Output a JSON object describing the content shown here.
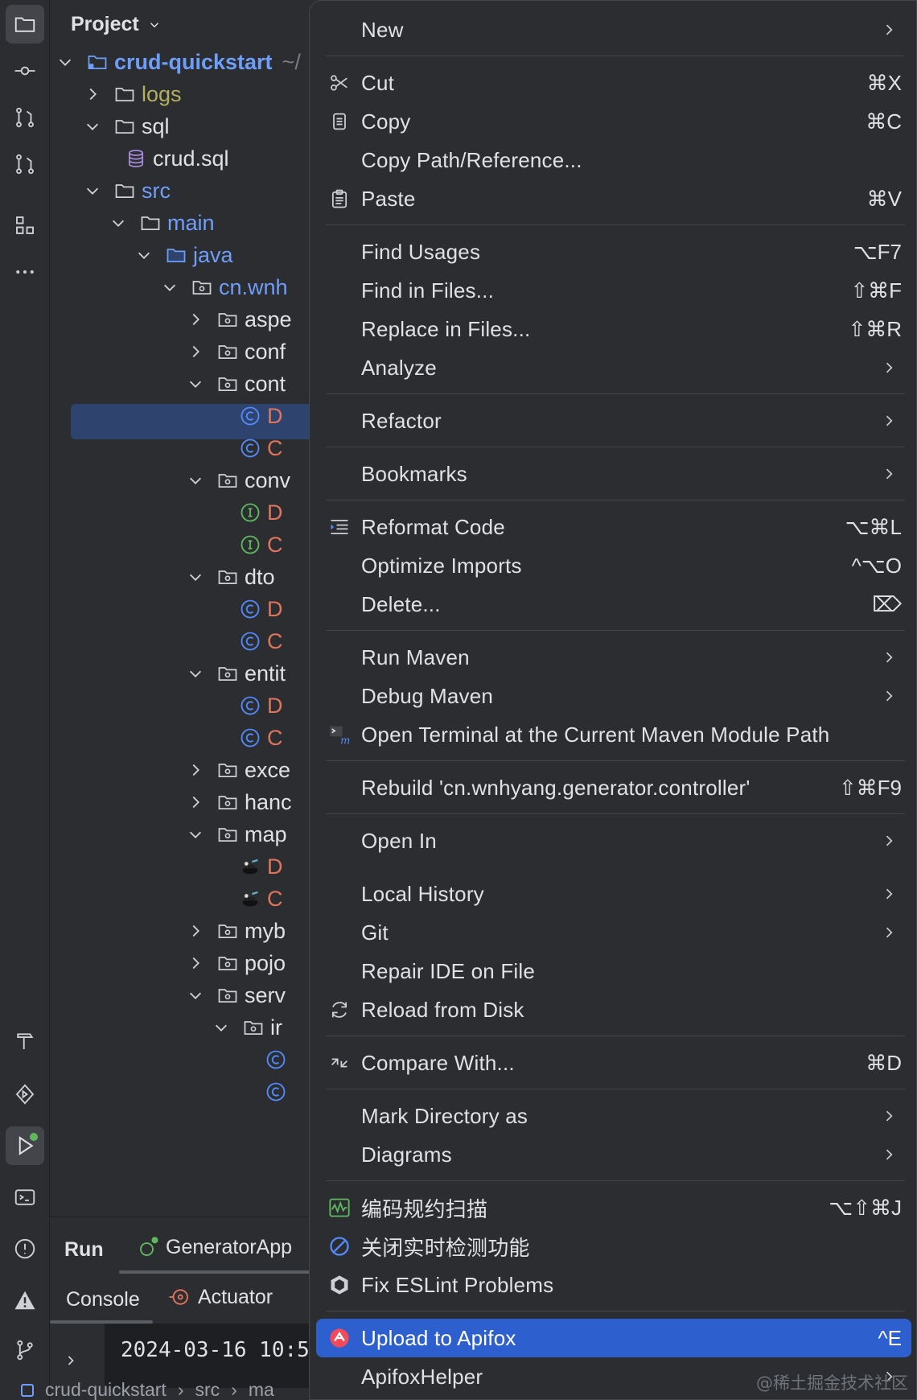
{
  "project_pane": {
    "title": "Project",
    "tree": [
      {
        "label": "crud-quickstart",
        "suffix": "~/",
        "color": "#6f9ef8",
        "bold": true,
        "icon": "module-folder-icon",
        "expanded": true
      },
      {
        "label": "logs",
        "color": "#b3ae60",
        "icon": "folder-icon",
        "expanded": false
      },
      {
        "label": "sql",
        "color": "#dfe1e5",
        "icon": "folder-icon",
        "expanded": true
      },
      {
        "label": "crud.sql",
        "color": "#dfe1e5",
        "icon": "database-icon"
      },
      {
        "label": "src",
        "color": "#6f9ef8",
        "icon": "folder-icon",
        "expanded": true
      },
      {
        "label": "main",
        "color": "#6f9ef8",
        "icon": "folder-icon",
        "expanded": true
      },
      {
        "label": "java",
        "color": "#6f9ef8",
        "icon": "source-folder-icon",
        "expanded": true
      },
      {
        "label": "cn.wnh",
        "color": "#6f9ef8",
        "icon": "package-icon",
        "expanded": true
      },
      {
        "label": "aspe",
        "icon": "package-icon",
        "expanded": false
      },
      {
        "label": "conf",
        "icon": "package-icon",
        "expanded": false
      },
      {
        "label": "cont",
        "icon": "package-icon",
        "expanded": true
      },
      {
        "label": "D",
        "icon": "class-icon",
        "color": "#e0745c"
      },
      {
        "label": "C",
        "icon": "class-icon",
        "color": "#e0745c"
      },
      {
        "label": "conv",
        "icon": "package-icon",
        "expanded": true
      },
      {
        "label": "D",
        "icon": "interface-icon",
        "color": "#e0745c"
      },
      {
        "label": "C",
        "icon": "interface-icon",
        "color": "#e0745c"
      },
      {
        "label": "dto",
        "icon": "package-icon",
        "expanded": true
      },
      {
        "label": "D",
        "icon": "class-icon",
        "color": "#e0745c"
      },
      {
        "label": "C",
        "icon": "class-icon",
        "color": "#e0745c"
      },
      {
        "label": "entit",
        "icon": "package-icon",
        "expanded": true
      },
      {
        "label": "D",
        "icon": "class-icon",
        "color": "#e0745c"
      },
      {
        "label": "C",
        "icon": "class-icon",
        "color": "#e0745c"
      },
      {
        "label": "exce",
        "icon": "package-icon",
        "expanded": false
      },
      {
        "label": "hanc",
        "icon": "package-icon",
        "expanded": false
      },
      {
        "label": "map",
        "icon": "package-icon",
        "expanded": true
      },
      {
        "label": "D",
        "icon": "mybatis-icon",
        "color": "#e0745c"
      },
      {
        "label": "C",
        "icon": "mybatis-icon",
        "color": "#e0745c"
      },
      {
        "label": "myb",
        "icon": "package-icon",
        "expanded": false
      },
      {
        "label": "pojo",
        "icon": "package-icon",
        "expanded": false
      },
      {
        "label": "serv",
        "icon": "package-icon",
        "expanded": true
      },
      {
        "label": "ir",
        "icon": "package-icon",
        "expanded": true
      },
      {
        "label": "",
        "icon": "class-icon"
      },
      {
        "label": "",
        "icon": "class-icon"
      }
    ]
  },
  "run_panel": {
    "title": "Run",
    "config_tab": "GeneratorApp",
    "tabs": [
      "Console",
      "Actuator"
    ],
    "console_line": "2024-03-16 10:5"
  },
  "status_bar": {
    "breadcrumb": [
      "crud-quickstart",
      "src",
      "ma"
    ]
  },
  "menu": {
    "items": [
      {
        "label": "New",
        "shortcut": "",
        "submenu": true,
        "icon": ""
      },
      {
        "label": "Cut",
        "shortcut": "⌘X",
        "submenu": false,
        "icon": "scissors-icon"
      },
      {
        "label": "Copy",
        "shortcut": "⌘C",
        "submenu": false,
        "icon": "copy-icon"
      },
      {
        "label": "Copy Path/Reference...",
        "shortcut": "",
        "submenu": false,
        "icon": ""
      },
      {
        "label": "Paste",
        "shortcut": "⌘V",
        "submenu": false,
        "icon": "paste-icon"
      },
      {
        "label": "Find Usages",
        "shortcut": "⌥F7",
        "submenu": false,
        "icon": ""
      },
      {
        "label": "Find in Files...",
        "shortcut": "⇧⌘F",
        "submenu": false,
        "icon": ""
      },
      {
        "label": "Replace in Files...",
        "shortcut": "⇧⌘R",
        "submenu": false,
        "icon": ""
      },
      {
        "label": "Analyze",
        "shortcut": "",
        "submenu": true,
        "icon": ""
      },
      {
        "label": "Refactor",
        "shortcut": "",
        "submenu": true,
        "icon": ""
      },
      {
        "label": "Bookmarks",
        "shortcut": "",
        "submenu": true,
        "icon": ""
      },
      {
        "label": "Reformat Code",
        "shortcut": "⌥⌘L",
        "submenu": false,
        "icon": "reformat-icon"
      },
      {
        "label": "Optimize Imports",
        "shortcut": "^⌥O",
        "submenu": false,
        "icon": ""
      },
      {
        "label": "Delete...",
        "shortcut": "⌦",
        "submenu": false,
        "icon": ""
      },
      {
        "label": "Run Maven",
        "shortcut": "",
        "submenu": true,
        "icon": ""
      },
      {
        "label": "Debug Maven",
        "shortcut": "",
        "submenu": true,
        "icon": ""
      },
      {
        "label": "Open Terminal at the Current Maven Module Path",
        "shortcut": "",
        "submenu": false,
        "icon": "maven-terminal-icon"
      },
      {
        "label": "Rebuild 'cn.wnhyang.generator.controller'",
        "shortcut": "⇧⌘F9",
        "submenu": false,
        "icon": ""
      },
      {
        "label": "Open In",
        "shortcut": "",
        "submenu": true,
        "icon": ""
      },
      {
        "label": "Local History",
        "shortcut": "",
        "submenu": true,
        "icon": ""
      },
      {
        "label": "Git",
        "shortcut": "",
        "submenu": true,
        "icon": ""
      },
      {
        "label": "Repair IDE on File",
        "shortcut": "",
        "submenu": false,
        "icon": ""
      },
      {
        "label": "Reload from Disk",
        "shortcut": "",
        "submenu": false,
        "icon": "reload-icon"
      },
      {
        "label": "Compare With...",
        "shortcut": "⌘D",
        "submenu": false,
        "icon": "compare-icon"
      },
      {
        "label": "Mark Directory as",
        "shortcut": "",
        "submenu": true,
        "icon": ""
      },
      {
        "label": "Diagrams",
        "shortcut": "",
        "submenu": true,
        "icon": ""
      },
      {
        "label": "编码规约扫描",
        "shortcut": "⌥⇧⌘J",
        "submenu": false,
        "icon": "code-scan-icon"
      },
      {
        "label": "关闭实时检测功能",
        "shortcut": "",
        "submenu": false,
        "icon": "disable-icon"
      },
      {
        "label": "Fix ESLint Problems",
        "shortcut": "",
        "submenu": false,
        "icon": "eslint-icon"
      },
      {
        "label": "Upload to Apifox",
        "shortcut": "^E",
        "submenu": false,
        "icon": "apifox-icon",
        "highlighted": true
      },
      {
        "label": "ApifoxHelper",
        "shortcut": "",
        "submenu": true,
        "icon": ""
      }
    ]
  },
  "watermark": "@稀土掘金技术社区",
  "colors": {
    "background": "#2b2d30",
    "selection": "#2e436e",
    "menu_highlight": "#2e5fcf",
    "text": "#dfe1e5",
    "link_blue": "#6f9ef8"
  }
}
